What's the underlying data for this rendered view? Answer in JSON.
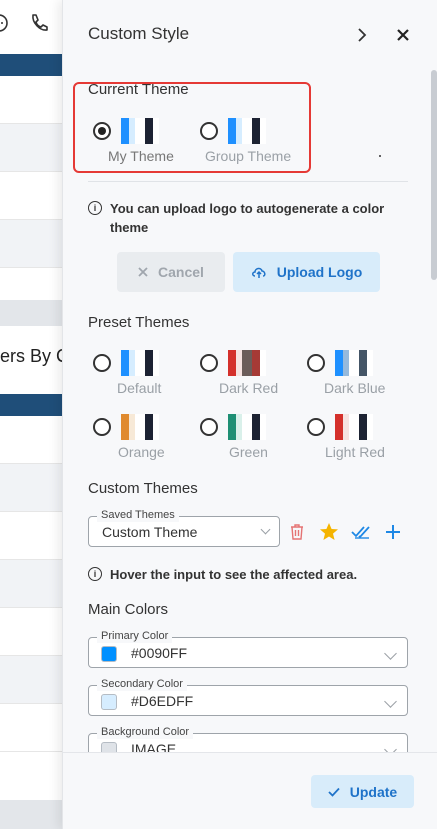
{
  "panel": {
    "title": "Custom Style",
    "current_theme": {
      "label": "Current Theme",
      "options": [
        {
          "label": "My Theme",
          "selected": true,
          "colors": [
            "#1e90ff",
            "#d6edff",
            "#ffffff",
            "#1d2333",
            "#ffffff"
          ]
        },
        {
          "label": "Group Theme",
          "selected": false,
          "colors": [
            "#1e90ff",
            "#d6edff",
            "#ffffff",
            "#1d2333",
            "#ffffff"
          ]
        }
      ]
    },
    "upload_info": "You can upload logo to autogenerate a color theme",
    "cancel_label": "Cancel",
    "upload_label": "Upload Logo",
    "preset": {
      "label": "Preset Themes",
      "options": [
        {
          "label": "Default",
          "colors": [
            "#1e90ff",
            "#d6edff",
            "#ffffff",
            "#1d2333",
            "#ffffff"
          ]
        },
        {
          "label": "Dark Red",
          "colors": [
            "#d4302b",
            "#f6e3e1",
            "#6b5d5a",
            "#a63a36",
            "#ffffff"
          ]
        },
        {
          "label": "Dark Blue",
          "colors": [
            "#1e90ff",
            "#95b9dc",
            "#ffffff",
            "#445566",
            "#ffffff"
          ]
        },
        {
          "label": "Orange",
          "colors": [
            "#e08a2e",
            "#f7e9d7",
            "#ffffff",
            "#1d2333",
            "#ffffff"
          ]
        },
        {
          "label": "Green",
          "colors": [
            "#1e8f74",
            "#d9f0ea",
            "#ffffff",
            "#1d2333",
            "#ffffff"
          ]
        },
        {
          "label": "Light Red",
          "colors": [
            "#d4302b",
            "#f6e3e1",
            "#ffffff",
            "#1d2333",
            "#ffffff"
          ]
        }
      ]
    },
    "custom_themes": {
      "label": "Custom Themes",
      "saved_legend": "Saved Themes",
      "saved_value": "Custom Theme"
    },
    "hover_info": "Hover the input to see the affected area.",
    "main_colors": {
      "label": "Main Colors",
      "fields": [
        {
          "legend": "Primary Color",
          "value": "#0090FF",
          "chip": "#0090ff"
        },
        {
          "legend": "Secondary Color",
          "value": "#D6EDFF",
          "chip": "#d6edff"
        },
        {
          "legend": "Background Color",
          "value": "IMAGE",
          "chip": "#dfe3e8"
        }
      ]
    },
    "update_label": "Update"
  },
  "background": {
    "title_fragment": "ers By C"
  }
}
